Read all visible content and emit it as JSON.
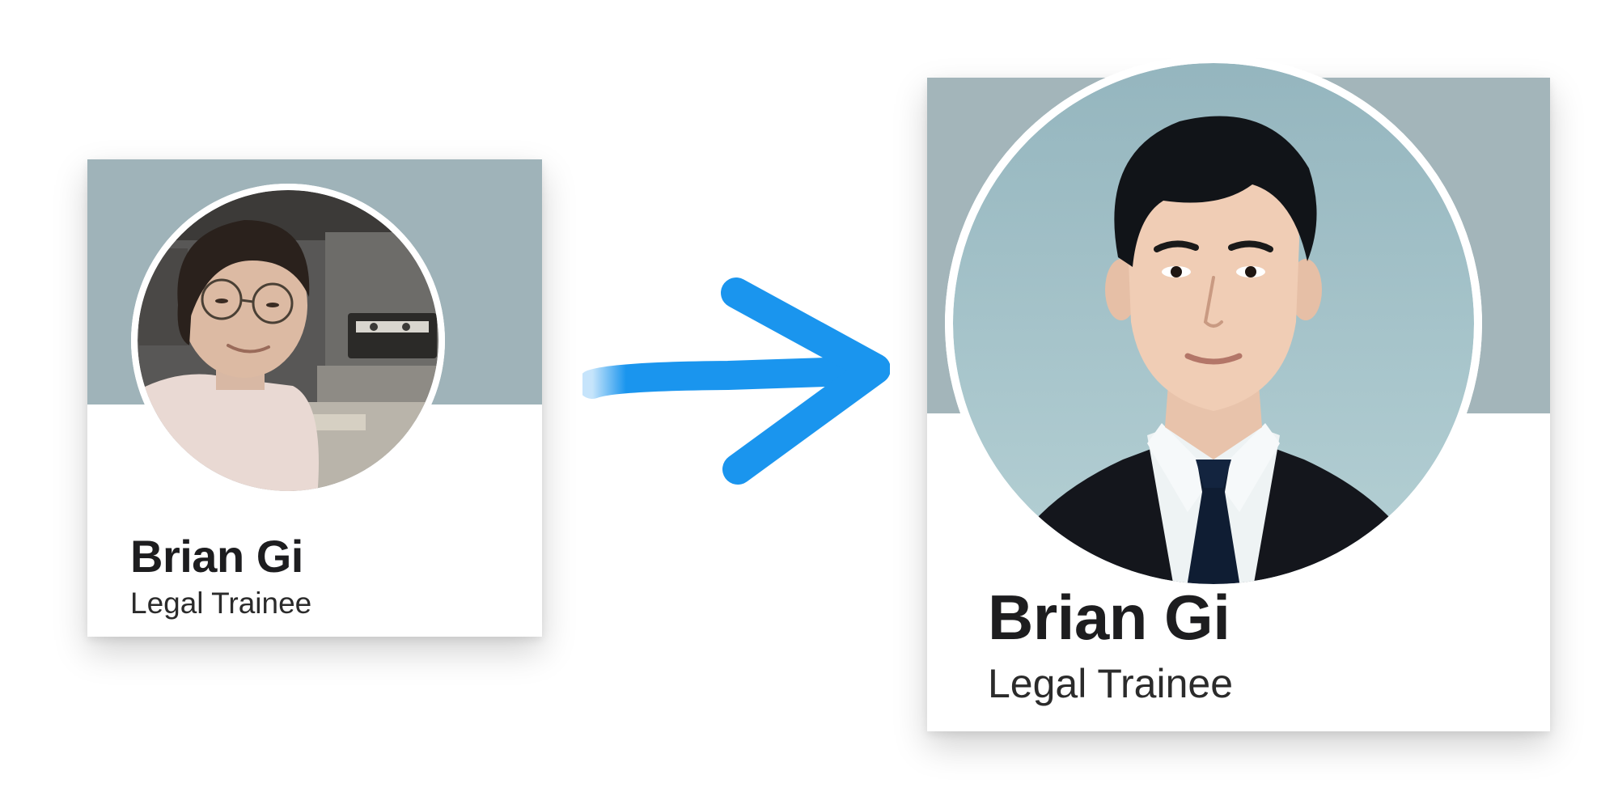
{
  "colors": {
    "banner": "#9fb3b9",
    "banner_after": "#a3b5ba",
    "arrow": "#1a95ee",
    "card_bg": "#ffffff",
    "name_text": "#1d1d1f"
  },
  "icons": {
    "arrow": "right-arrow-icon"
  },
  "before_card": {
    "name": "Brian Gi",
    "title": "Legal Trainee"
  },
  "after_card": {
    "name": "Brian Gi",
    "title": "Legal Trainee"
  }
}
